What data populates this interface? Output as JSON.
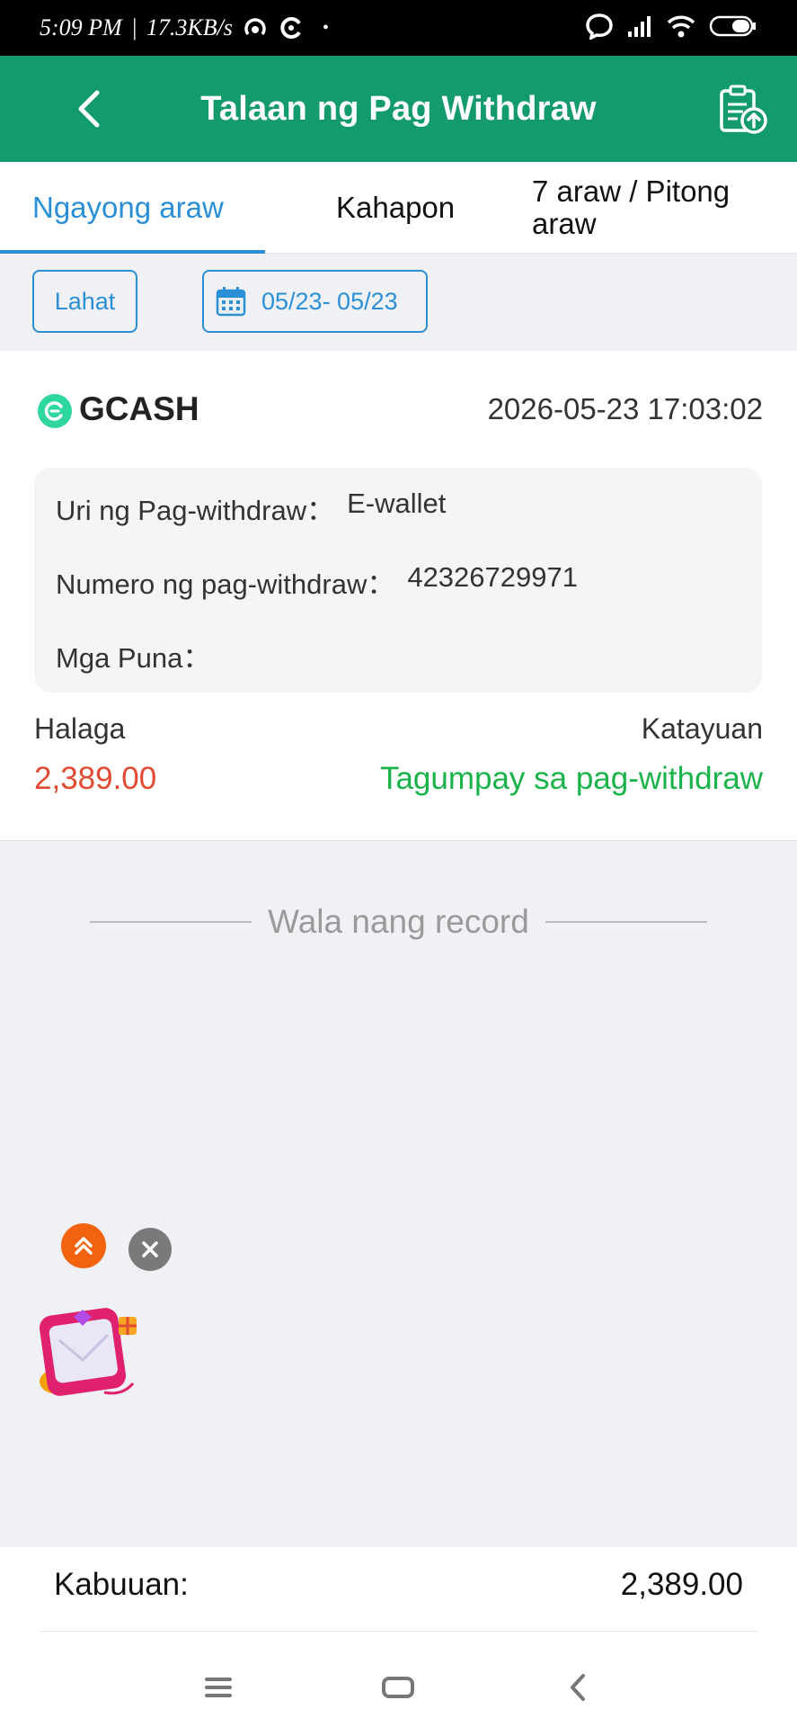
{
  "status_bar": {
    "time": "5:09 PM",
    "separator": "|",
    "speed": "17.3KB/s",
    "dot": "•",
    "icons": [
      "hotspot-icon",
      "sync-icon",
      "chat-icon",
      "signal-icon",
      "wifi-icon",
      "battery-icon"
    ]
  },
  "header": {
    "title": "Talaan ng Pag Withdraw",
    "back_icon": "chevron-left-icon",
    "action_icon": "clipboard-upload-icon"
  },
  "tabs": [
    {
      "label": "Ngayong araw",
      "active": true
    },
    {
      "label": "Kahapon",
      "active": false
    },
    {
      "label": "7 araw / Pitong araw",
      "active": false
    }
  ],
  "filters": {
    "all_label": "Lahat",
    "date_range": "05/23- 05/23",
    "calendar_icon": "calendar-icon"
  },
  "record": {
    "provider": "GCASH",
    "datetime": "2026-05-23 17:03:02",
    "type_label": "Uri ng Pag-withdraw：",
    "type_value": "E-wallet",
    "number_label": "Numero ng pag-withdraw：",
    "number_value": "42326729971",
    "remarks_label": "Mga Puna：",
    "remarks_value": "",
    "amount_label": "Halaga",
    "amount_value": "2,389.00",
    "status_label": "Katayuan",
    "status_value": "Tagumpay sa pag-withdraw"
  },
  "no_more": "Wala nang record",
  "footer": {
    "total_label": "Kabuuan:",
    "total_value": "2,389.00"
  },
  "colors": {
    "header_bg": "#139a6e",
    "accent_blue": "#2a8fd6",
    "amount_red": "#e24a33",
    "status_green": "#19b34a"
  }
}
